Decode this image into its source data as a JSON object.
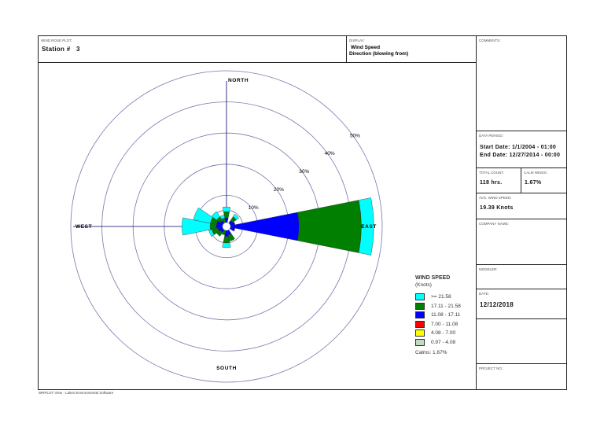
{
  "header": {
    "plot_label": "WIND ROSE PLOT:",
    "station": "Station #   3",
    "display_label": "DISPLAY:",
    "display_line1": "Wind Speed",
    "display_line2": "Direction (blowing from)"
  },
  "sidebar": {
    "comments_label": "COMMENTS:",
    "data_period_label": "DATA PERIOD:",
    "start_date": "Start Date: 1/1/2004 - 01:00",
    "end_date": "End Date: 12/27/2014 - 00:00",
    "total_count_label": "TOTAL COUNT:",
    "total_count": "118 hrs.",
    "calm_winds_label": "CALM WINDS:",
    "calm_winds": "1.67%",
    "avg_speed_label": "AVG. WIND SPEED:",
    "avg_speed": "19.39 Knots",
    "company_label": "COMPANY NAME:",
    "modeler_label": "MODELER:",
    "date_label": "DATE:",
    "date": "12/12/2018",
    "project_label": "PROJECT NO.:"
  },
  "footer": "WRPLOT View - Lakes Environmental Software",
  "chart_data": {
    "type": "wind-rose",
    "directions": [
      "N",
      "NNE",
      "NE",
      "ENE",
      "E",
      "ESE",
      "SE",
      "SSE",
      "S",
      "SSW",
      "SW",
      "WSW",
      "W",
      "WNW",
      "NW",
      "NNW"
    ],
    "compass_labels": {
      "north": "NORTH",
      "south": "SOUTH",
      "east": "EAST",
      "west": "WEST"
    },
    "rings": [
      10,
      20,
      30,
      40,
      50
    ],
    "ring_labels": [
      "10%",
      "20%",
      "30%",
      "40%",
      "50%"
    ],
    "legend_title": "WIND SPEED",
    "legend_units": "(Knots)",
    "calms": "Calms: 1.67%",
    "series": [
      {
        "name": ">= 21.58",
        "color": "#00ffff",
        "values": [
          1.5,
          0,
          1,
          0,
          4,
          0,
          0,
          0,
          1.5,
          0,
          0,
          1,
          9,
          5.5,
          2,
          1
        ]
      },
      {
        "name": "17.11 - 21.58",
        "color": "#007f00",
        "values": [
          2,
          0,
          1.5,
          0,
          20,
          0,
          0,
          2,
          2,
          1.5,
          1.5,
          2,
          2,
          2,
          1.5,
          1.5
        ]
      },
      {
        "name": "11.08 - 17.11",
        "color": "#0000ff",
        "values": [
          1.5,
          0,
          1,
          1.5,
          22,
          1.5,
          0,
          1.5,
          2,
          0,
          1,
          1.5,
          2,
          2,
          1,
          0
        ]
      },
      {
        "name": "7.00 - 11.08",
        "color": "#ff0000",
        "values": [
          0,
          0,
          0,
          0,
          0,
          0,
          0,
          0,
          0,
          0,
          0,
          0,
          0,
          0,
          0,
          0
        ]
      },
      {
        "name": "4.08 - 7.00",
        "color": "#ffff00",
        "values": [
          0,
          0,
          0,
          0,
          0,
          0,
          0,
          0,
          0,
          0,
          0,
          0,
          0,
          0,
          0,
          0
        ]
      },
      {
        "name": "0.97 - 4.08",
        "color": "#c0dcc0",
        "values": [
          0,
          0,
          0,
          0,
          0,
          0,
          0,
          0,
          0,
          0,
          0,
          0,
          0,
          0,
          0,
          0
        ]
      }
    ]
  }
}
